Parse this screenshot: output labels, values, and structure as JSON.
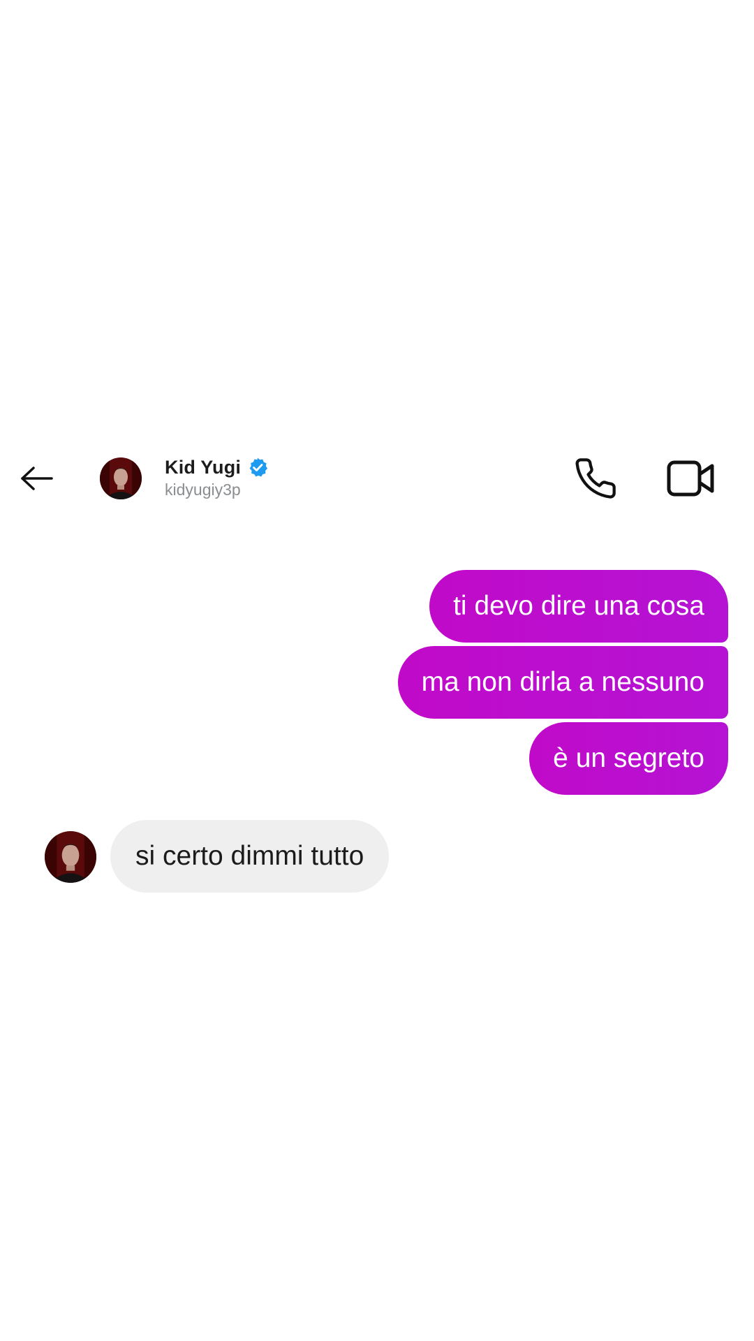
{
  "header": {
    "contact_name": "Kid Yugi",
    "contact_handle": "kidyugiy3p",
    "verified": true,
    "icons": {
      "back": "arrow-left-icon",
      "call": "phone-icon",
      "video": "video-camera-icon",
      "verified": "verified-badge-icon"
    }
  },
  "conversation": {
    "outgoing": [
      {
        "text": "ti devo dire una cosa"
      },
      {
        "text": "ma non dirla a nessuno"
      },
      {
        "text": "è un segreto"
      }
    ],
    "incoming": [
      {
        "text": "si certo dimmi tutto"
      }
    ]
  },
  "colors": {
    "outgoing_bubble": "#c10ac9",
    "incoming_bubble": "#efefef",
    "verified_badge": "#1d9bf0"
  }
}
